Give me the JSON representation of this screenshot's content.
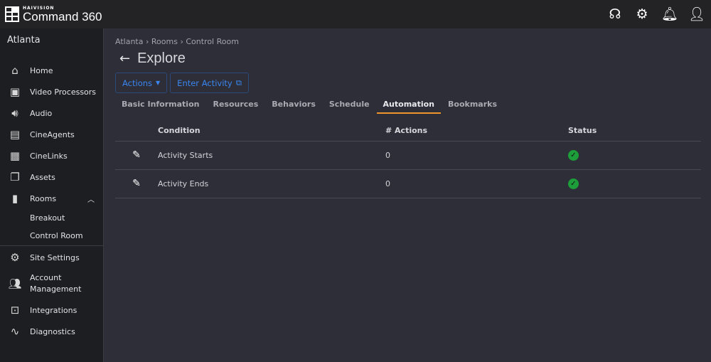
{
  "header": {
    "brand": "HAIVISION",
    "product": "Command 360",
    "icons": [
      "headset-icon",
      "settings-icon",
      "bell-icon",
      "user-icon"
    ]
  },
  "sidebar": {
    "site": "Atlanta",
    "items": [
      {
        "label": "Home",
        "icon": "home-icon"
      },
      {
        "label": "Video Processors",
        "icon": "processor-icon"
      },
      {
        "label": "Audio",
        "icon": "speaker-icon"
      },
      {
        "label": "CineAgents",
        "icon": "agent-icon"
      },
      {
        "label": "CineLinks",
        "icon": "link-icon"
      },
      {
        "label": "Assets",
        "icon": "assets-icon"
      },
      {
        "label": "Rooms",
        "icon": "door-icon"
      },
      {
        "label": "Breakout"
      },
      {
        "label": "Control Room"
      },
      {
        "label": "Site Settings",
        "icon": "gear-icon"
      },
      {
        "label": "Account Management",
        "icon": "users-icon"
      },
      {
        "label": "Integrations",
        "icon": "terminal-icon"
      },
      {
        "label": "Diagnostics",
        "icon": "pulse-icon"
      }
    ]
  },
  "breadcrumb": [
    "Atlanta",
    "Rooms",
    "Control Room"
  ],
  "breadcrumb_sep": "›",
  "page_title": "Explore",
  "buttons": {
    "actions": "Actions",
    "enter_activity": "Enter Activity"
  },
  "tabs": [
    "Basic Information",
    "Resources",
    "Behaviors",
    "Schedule",
    "Automation",
    "Bookmarks"
  ],
  "active_tab": "Automation",
  "table": {
    "headers": [
      "Condition",
      "# Actions",
      "Status"
    ],
    "rows": [
      {
        "condition": "Activity Starts",
        "actions": "0",
        "status": "ok"
      },
      {
        "condition": "Activity Ends",
        "actions": "0",
        "status": "ok"
      }
    ]
  },
  "colors": {
    "accent": "#3b86f0",
    "tab_underline": "#f0942c",
    "status_ok": "#1e9e3a"
  }
}
